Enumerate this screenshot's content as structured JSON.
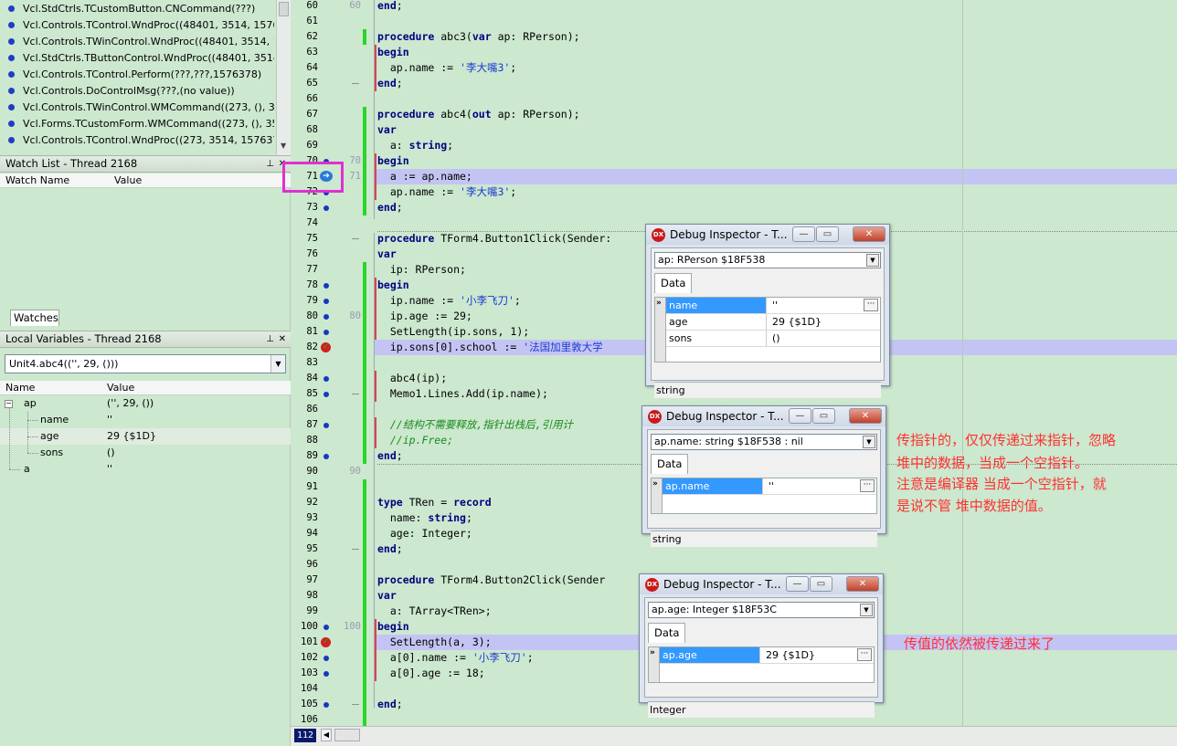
{
  "call_stack": {
    "rows": [
      "Vcl.StdCtrls.TCustomButton.CNCommand(???)",
      "Vcl.Controls.TControl.WndProc((48401, 3514, 15763",
      "Vcl.Controls.TWinControl.WndProc((48401, 3514, 15",
      "Vcl.StdCtrls.TButtonControl.WndProc((48401, 3514,",
      "Vcl.Controls.TControl.Perform(???,???,1576378)",
      "Vcl.Controls.DoControlMsg(???,(no value))",
      "Vcl.Controls.TWinControl.WMCommand((273, (), 35",
      "Vcl.Forms.TCustomForm.WMCommand((273, (), 35",
      "Vcl.Controls.TControl.WndProc((273, 3514, 1576378,"
    ]
  },
  "watch_list": {
    "title": "Watch List - Thread 2168",
    "col_name": "Watch Name",
    "col_value": "Value",
    "tab": "Watches"
  },
  "local_vars": {
    "title": "Local Variables - Thread 2168",
    "combo": "Unit4.abc4(('', 29, ()))",
    "col_name": "Name",
    "col_value": "Value",
    "rows": [
      {
        "name": "ap",
        "value": "('', 29, ())"
      },
      {
        "name": "name",
        "value": "''"
      },
      {
        "name": "age",
        "value": "29 {$1D}"
      },
      {
        "name": "sons",
        "value": "()"
      },
      {
        "name": "a",
        "value": "''"
      }
    ]
  },
  "editor": {
    "current_line_indicator": "112",
    "lines": [
      {
        "n": "60",
        "code": "end;"
      },
      {
        "n": "61",
        "code": ""
      },
      {
        "n": "62",
        "code": "procedure abc3(var ap: RPerson);"
      },
      {
        "n": "63",
        "code": "begin"
      },
      {
        "n": "64",
        "code": "  ap.name := '李大嘴3';"
      },
      {
        "n": "65",
        "code": "end;"
      },
      {
        "n": "66",
        "code": ""
      },
      {
        "n": "67",
        "code": "procedure abc4(out ap: RPerson);"
      },
      {
        "n": "68",
        "code": "var"
      },
      {
        "n": "69",
        "code": "  a: string;"
      },
      {
        "n": "70",
        "code": "begin"
      },
      {
        "n": "71",
        "code": "  a := ap.name;"
      },
      {
        "n": "72",
        "code": "  ap.name := '李大嘴3';"
      },
      {
        "n": "73",
        "code": "end;"
      },
      {
        "n": "74",
        "code": ""
      },
      {
        "n": "75",
        "code": "procedure TForm4.Button1Click(Sender:"
      },
      {
        "n": "76",
        "code": "var"
      },
      {
        "n": "77",
        "code": "  ip: RPerson;"
      },
      {
        "n": "78",
        "code": "begin"
      },
      {
        "n": "79",
        "code": "  ip.name := '小李飞刀';"
      },
      {
        "n": "80",
        "code": "  ip.age := 29;"
      },
      {
        "n": "81",
        "code": "  SetLength(ip.sons, 1);"
      },
      {
        "n": "82",
        "code": "  ip.sons[0].school := '法国加里敦大学"
      },
      {
        "n": "83",
        "code": ""
      },
      {
        "n": "84",
        "code": "  abc4(ip);"
      },
      {
        "n": "85",
        "code": "  Memo1.Lines.Add(ip.name);"
      },
      {
        "n": "86",
        "code": ""
      },
      {
        "n": "87",
        "code": "  //结构不需要释放,指针出栈后,引用计"
      },
      {
        "n": "88",
        "code": "  //ip.Free;"
      },
      {
        "n": "89",
        "code": "end;"
      },
      {
        "n": "90",
        "code": ""
      },
      {
        "n": "91",
        "code": ""
      },
      {
        "n": "92",
        "code": "type TRen = record"
      },
      {
        "n": "93",
        "code": "  name: string;"
      },
      {
        "n": "94",
        "code": "  age: Integer;"
      },
      {
        "n": "95",
        "code": "end;"
      },
      {
        "n": "96",
        "code": ""
      },
      {
        "n": "97",
        "code": "procedure TForm4.Button2Click(Sender"
      },
      {
        "n": "98",
        "code": "var"
      },
      {
        "n": "99",
        "code": "  a: TArray<TRen>;"
      },
      {
        "n": "100",
        "code": "begin"
      },
      {
        "n": "101",
        "code": "  SetLength(a, 3);"
      },
      {
        "n": "102",
        "code": "  a[0].name := '小李飞刀';"
      },
      {
        "n": "103",
        "code": "  a[0].age := 18;"
      },
      {
        "n": "104",
        "code": ""
      },
      {
        "n": "105",
        "code": "end;"
      },
      {
        "n": "106",
        "code": ""
      }
    ],
    "grey_numbers": [
      {
        "line": "60",
        "text": "60"
      },
      {
        "line": "70",
        "text": "70"
      },
      {
        "line": "71",
        "text": "71"
      },
      {
        "line": "80",
        "text": "80"
      },
      {
        "line": "90",
        "text": "90"
      },
      {
        "line": "100",
        "text": "100"
      }
    ]
  },
  "inspectors": [
    {
      "title": "Debug Inspector - T...",
      "combo": "ap: RPerson $18F538",
      "tab": "Data",
      "rows": [
        {
          "key": "name",
          "value": "''",
          "selected": true
        },
        {
          "key": "age",
          "value": "29 {$1D}",
          "selected": false
        },
        {
          "key": "sons",
          "value": "()",
          "selected": false
        }
      ],
      "status": "string"
    },
    {
      "title": "Debug Inspector - T...",
      "combo": "ap.name: string $18F538 : nil",
      "tab": "Data",
      "rows": [
        {
          "key": "ap.name",
          "value": "''",
          "selected": true
        }
      ],
      "status": "string"
    },
    {
      "title": "Debug Inspector - T...",
      "combo": "ap.age: Integer $18F53C",
      "tab": "Data",
      "rows": [
        {
          "key": "ap.age",
          "value": "29 {$1D}",
          "selected": true
        }
      ],
      "status": "Integer"
    }
  ],
  "annotations": {
    "note1_line1": "传指针的，仅仅传递过来指针，忽略",
    "note1_line2": " 堆中的数据，当成一个空指针。",
    "note1_line3": "注意是编译器 当成一个空指针，就",
    "note1_line4": "是说不管 堆中数据的值。",
    "note2": "传值的依然被传递过来了"
  },
  "colors": {
    "editor_bg": "#cce8cf",
    "exec_line_highlight": "#c4c4f4",
    "annotation_red": "#ff3030",
    "keyword": "#000080",
    "string": "#1b3ad0",
    "comment": "#1a8a1a"
  }
}
